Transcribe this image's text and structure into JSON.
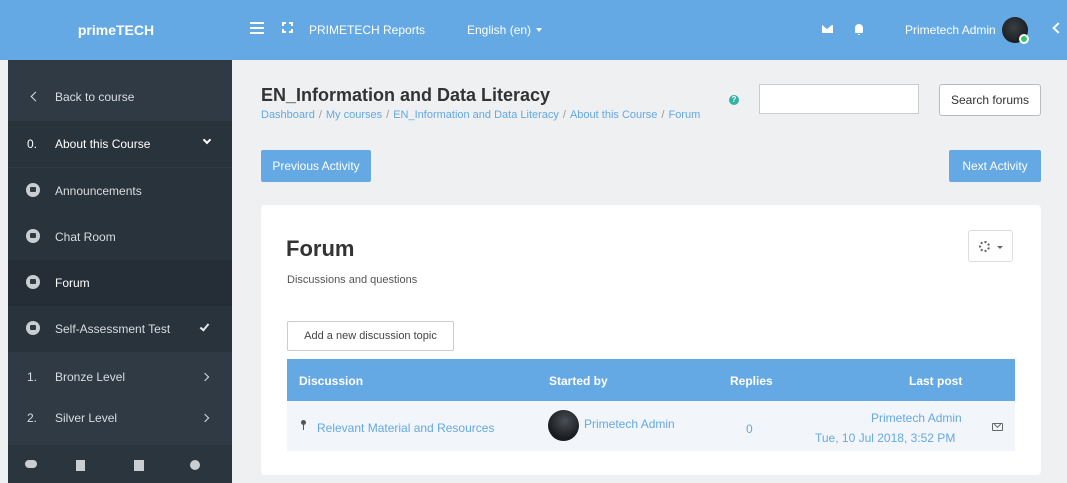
{
  "topbar": {
    "brand": "primeTECH",
    "reports": "PRIMETECH Reports",
    "language": "English (en)",
    "user": "Primetech Admin"
  },
  "sidebar": {
    "back": "Back to course",
    "section0_num": "0.",
    "section0": "About this Course",
    "items": [
      {
        "label": "Announcements"
      },
      {
        "label": "Chat Room"
      },
      {
        "label": "Forum"
      },
      {
        "label": "Self-Assessment Test"
      }
    ],
    "section1_num": "1.",
    "section1": "Bronze Level",
    "section2_num": "2.",
    "section2": "Silver Level"
  },
  "header": {
    "course_title": "EN_Information and Data Literacy",
    "breadcrumb": [
      "Dashboard",
      "My courses",
      "EN_Information and Data Literacy",
      "About this Course",
      "Forum"
    ],
    "search_button": "Search forums",
    "search_value": ""
  },
  "nav": {
    "previous": "Previous Activity",
    "next": "Next Activity"
  },
  "forum": {
    "title": "Forum",
    "description": "Discussions and questions",
    "add_topic": "Add a new discussion topic",
    "columns": [
      "Discussion",
      "Started by",
      "Replies",
      "Last post"
    ],
    "rows": [
      {
        "discussion": "Relevant Material and Resources",
        "started_by": "Primetech Admin",
        "replies": "0",
        "last_post_user": "Primetech Admin",
        "last_post_date": "Tue, 10 Jul 2018, 3:52 PM"
      }
    ]
  },
  "colors": {
    "accent": "#64a8e4",
    "sidebar": "#2f3a44",
    "help": "#2fb4a2"
  }
}
